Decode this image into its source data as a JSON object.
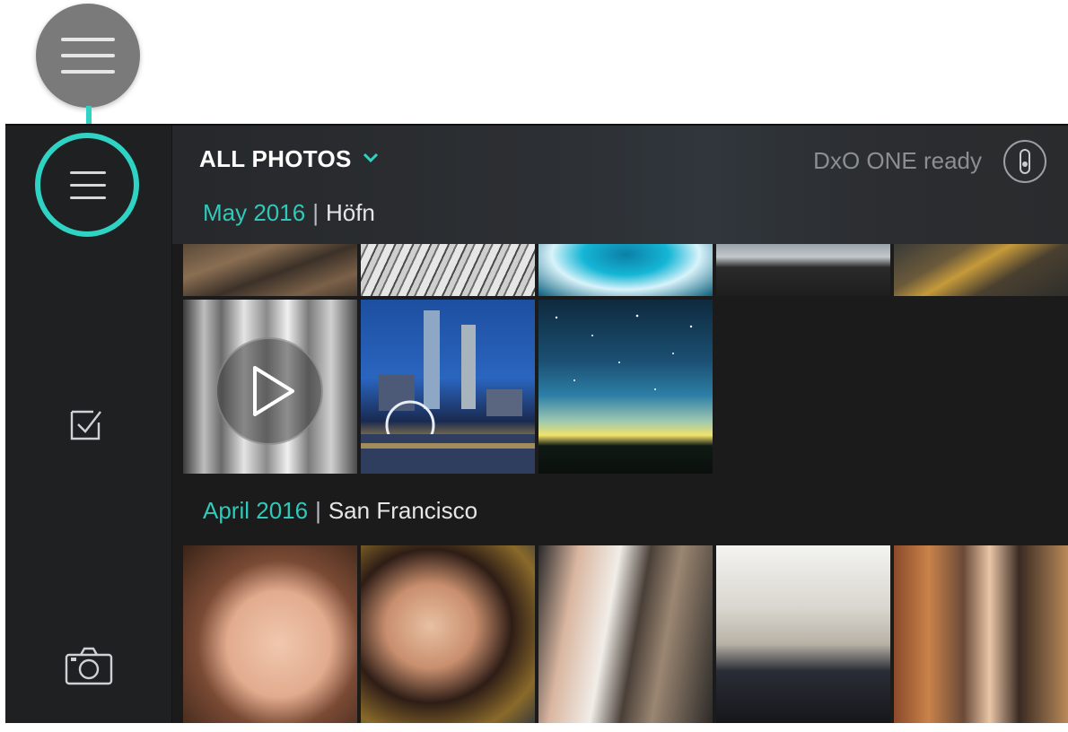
{
  "header": {
    "title": "ALL PHOTOS",
    "camera_status": "DxO ONE ready"
  },
  "sections": [
    {
      "date": "May 2016",
      "separator": "|",
      "place": "Höfn"
    },
    {
      "date": "April 2016",
      "separator": "|",
      "place": "San Francisco"
    }
  ],
  "icons": {
    "callout": "hamburger-menu-icon",
    "menu": "hamburger-menu-icon",
    "select": "checkbox-select-icon",
    "camera": "camera-icon",
    "camera_status": "dxo-one-camera-icon",
    "dropdown": "chevron-down-icon",
    "play": "play-icon"
  },
  "colors": {
    "accent": "#2fd3c3",
    "section_date": "#2fc9b9",
    "callout_bubble": "#7a7a7a"
  }
}
